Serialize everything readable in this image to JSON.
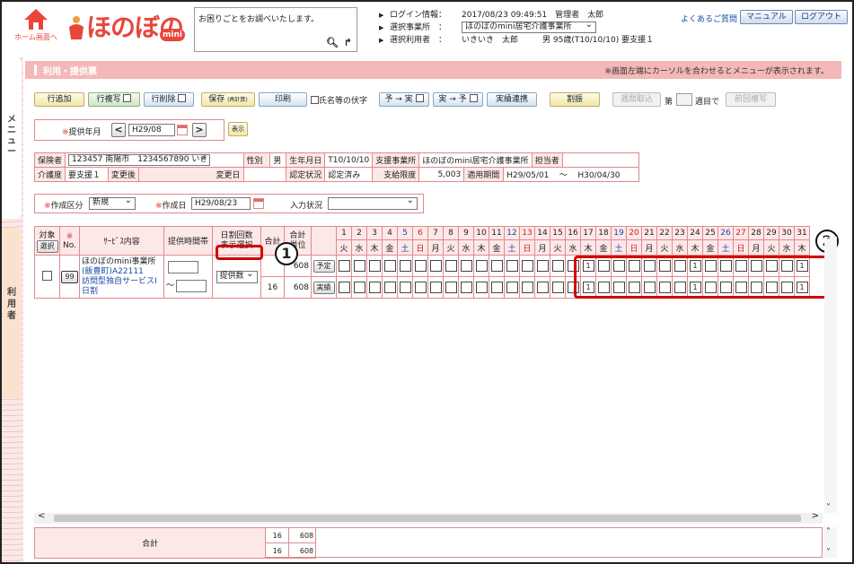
{
  "header": {
    "home_label": "ホーム画面へ",
    "logo_text": "ほのぼの",
    "logo_badge": "mini",
    "search_placeholder": "お困りごとをお調べいたします。",
    "login_key": "ログイン情報：",
    "login_value": "2017/08/23 09:49:51　管理者　太郎",
    "office_key": "選択事業所　：",
    "office_value": "ほのぼのmini居宅介護事業所",
    "user_key": "選択利用者　：",
    "user_value": "いきいき　太郎　　　男 95歳(T10/10/10) 要支援１",
    "faq": "よくあるご質問",
    "manual": "マニュアル",
    "logout": "ログアウト"
  },
  "sidebar": {
    "menu_tab": "メニュー",
    "user_tab": "利用者"
  },
  "page": {
    "title": "利用・提供票",
    "note": "※画面左端にカーソルを合わせるとメニューが表示されます。"
  },
  "toolbar": {
    "add_row": "行追加",
    "copy_row": "行複写",
    "delete_row": "行削除",
    "save": "保存",
    "save_sub": "(再計算)",
    "print": "印刷",
    "name_check": "氏名等の伏字",
    "plan_to_actual": "予 → 実",
    "actual_to_plan": "実 → 予",
    "actual_link": "実績連携",
    "allocate": "割振",
    "weekly_import": "週間取込",
    "week_prefix": "第",
    "week_suffix": "週目で",
    "prev_copy": "前回複写"
  },
  "period": {
    "label": "提供年月",
    "value": "H29/08",
    "show": "表示"
  },
  "insured": {
    "insurer_label": "保険者",
    "insurer_value": "123457 南陽市　1234567890 いき",
    "sex_label": "性別",
    "sex_value": "男",
    "birth_label": "生年月日",
    "birth_value": "T10/10/10",
    "office_label": "支援事業所",
    "office_value": "ほのぼのmini居宅介護事業所",
    "manager_label": "担当者",
    "manager_value": "",
    "care_label": "介護度",
    "care_value": "要支援１",
    "after_label": "変更後",
    "after_value": "",
    "change_date_label": "変更日",
    "change_date_value": "",
    "cert_label": "認定状況",
    "cert_value": "認定済み",
    "limit_label": "支給限度",
    "limit_value": "5,003",
    "period_label": "適用期間",
    "period_from": "H29/05/01",
    "period_tilde": "〜",
    "period_to": "H30/04/30"
  },
  "creation": {
    "kind_label": "作成区分",
    "kind_value": "新規",
    "date_label": "作成日",
    "date_value": "H29/08/23",
    "input_label": "入力状況",
    "input_value": ""
  },
  "grid": {
    "col_target": "対象",
    "col_select": "選択",
    "col_no": "No.",
    "col_service": "ｻｰﾋﾞｽ内容",
    "col_time": "提供時間帯",
    "col_daily": "日割回数\n表示選択",
    "col_total": "合計",
    "col_units": "合計\n単位",
    "days": [
      "1",
      "2",
      "3",
      "4",
      "5",
      "6",
      "7",
      "8",
      "9",
      "10",
      "11",
      "12",
      "13",
      "14",
      "15",
      "16",
      "17",
      "18",
      "19",
      "20",
      "21",
      "22",
      "23",
      "24",
      "25",
      "26",
      "27",
      "28",
      "29",
      "30",
      "31"
    ],
    "weekdays": [
      "火",
      "水",
      "木",
      "金",
      "土",
      "日",
      "月",
      "火",
      "水",
      "木",
      "金",
      "土",
      "日",
      "月",
      "火",
      "水",
      "木",
      "金",
      "土",
      "日",
      "月",
      "火",
      "水",
      "木",
      "金",
      "土",
      "日",
      "月",
      "火",
      "水",
      "木"
    ],
    "row": {
      "no": "99",
      "service_lines": [
        "ほのぼのmini事業所",
        "(飯豊町)A22111",
        "訪問型独自サービスⅠ",
        "日割"
      ],
      "tilde": "〜",
      "daily_select": "提供数",
      "plan_total": "",
      "plan_units": "608",
      "actual_total": "16",
      "actual_units": "608",
      "plan_btn": "予定",
      "actual_btn": "実績",
      "plan_marks": {
        "17": "1",
        "24": "1",
        "31": "1"
      },
      "actual_marks": {
        "17": "1",
        "24": "1",
        "31": "1"
      }
    }
  },
  "totals": {
    "label": "合計",
    "plan_total": "16",
    "plan_units": "608",
    "actual_total": "16",
    "actual_units": "608"
  },
  "callouts": {
    "one": "1",
    "two": "2"
  },
  "colors": {
    "accent": "#e8463c",
    "title_bar": "#f4b8b8",
    "border": "#e08a8a",
    "highlight": "#d40000"
  }
}
